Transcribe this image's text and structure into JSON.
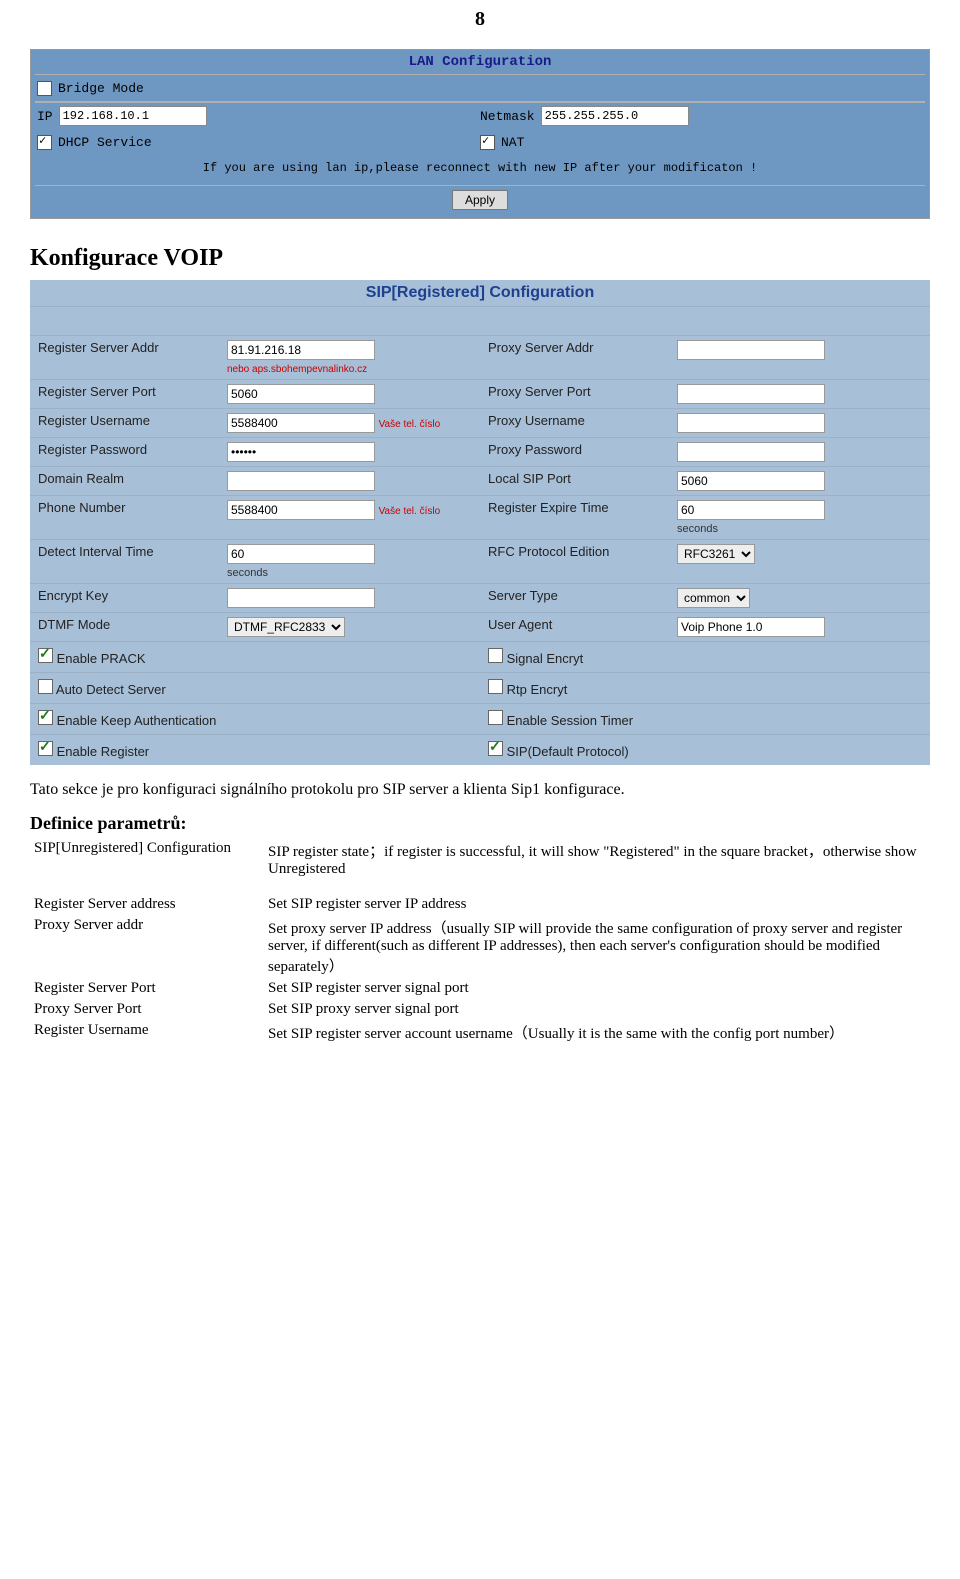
{
  "page_number": "8",
  "lan": {
    "title": "LAN Configuration",
    "bridge_mode": "Bridge Mode",
    "ip_label": "IP",
    "ip_value": "192.168.10.1",
    "netmask_label": "Netmask",
    "netmask_value": "255.255.255.0",
    "dhcp_service": "DHCP Service",
    "nat": "NAT",
    "note": "If you are using lan ip,please reconnect with new IP after your modificaton !",
    "apply": "Apply"
  },
  "section_voip": "Konfigurace VOIP",
  "sip": {
    "title": "SIP[Registered] Configuration",
    "rows": [
      [
        "Register Server Addr",
        "81.91.216.18",
        "Proxy Server Addr",
        ""
      ],
      [
        "Register Server Port",
        "5060",
        "Proxy Server Port",
        ""
      ],
      [
        "Register Username",
        "5588400",
        "Proxy Username",
        ""
      ],
      [
        "Register Password",
        "••••••",
        "Proxy Password",
        ""
      ],
      [
        "Domain Realm",
        "",
        "Local SIP Port",
        "5060"
      ],
      [
        "Phone Number",
        "5588400",
        "Register Expire Time",
        "60"
      ],
      [
        "Detect Interval Time",
        "60",
        "RFC Protocol Edition",
        ""
      ],
      [
        "Encrypt Key",
        "",
        "Server Type",
        ""
      ],
      [
        "DTMF Mode",
        "",
        "User Agent",
        "Voip Phone 1.0"
      ]
    ],
    "addr_note": "nebo aps.sbohempevnalinko.cz",
    "tel_note": "Vaše tel. číslo",
    "seconds": "seconds",
    "rfc_option": "RFC3261",
    "servertype_option": "common",
    "dtmf_option": "DTMF_RFC2833",
    "checks": [
      [
        "Enable PRACK",
        true,
        "Signal Encryt",
        false
      ],
      [
        "Auto Detect Server",
        false,
        "Rtp Encryt",
        false
      ],
      [
        "Enable Keep Authentication",
        true,
        "Enable Session Timer",
        false
      ],
      [
        "Enable Register",
        true,
        "SIP(Default Protocol)",
        true
      ]
    ]
  },
  "intro": "Tato sekce je pro konfiguraci signálního protokolu pro SIP server a klienta Sip1 konfigurace.",
  "def_heading": "Definice parametrů:",
  "defs": [
    [
      "SIP[Unregistered] Configuration",
      "SIP register state；if register is successful, it will show \"Registered\" in the square bracket，otherwise show Unregistered"
    ],
    [
      "Register Server address",
      "Set SIP register server IP address"
    ],
    [
      "Proxy Server addr",
      "Set proxy server IP address（usually SIP will provide the same configuration of proxy server and register server, if different(such as different IP addresses), then each server's configuration should be modified separately）"
    ],
    [
      "Register Server Port",
      "Set SIP register server signal port"
    ],
    [
      "Proxy Server Port",
      "Set SIP proxy server signal port"
    ],
    [
      "Register Username",
      "Set SIP register server account username（Usually it is the same with the config port number）"
    ]
  ]
}
